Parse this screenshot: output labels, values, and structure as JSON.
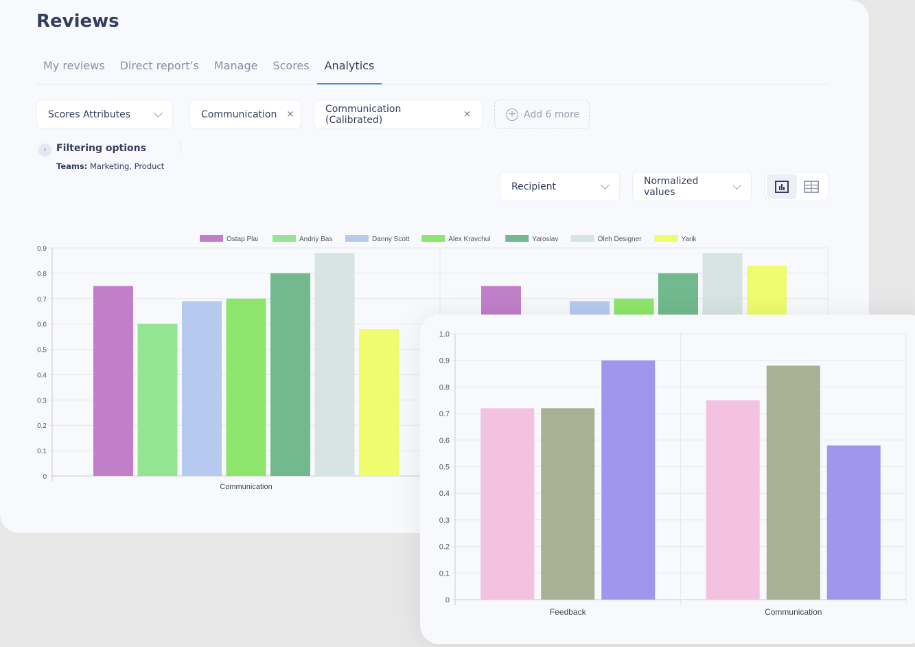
{
  "header": {
    "title": "Reviews"
  },
  "tabs": [
    {
      "label": "My reviews"
    },
    {
      "label": "Direct report’s"
    },
    {
      "label": "Manage"
    },
    {
      "label": "Scores"
    },
    {
      "label": "Analytics",
      "active": true
    }
  ],
  "filters": {
    "attribute_select": "Scores Attributes",
    "chips": [
      "Communication",
      "Communication (Calibrated)"
    ],
    "remove_icon": "×",
    "add_more": "Add 6 more"
  },
  "filtering": {
    "title": "Filtering options",
    "teams_label": "Teams:",
    "teams_value": "Marketing, Product"
  },
  "controls": {
    "group_by": "Recipient",
    "value_mode": "Normalized values",
    "view_toggle": [
      "bar-chart-icon",
      "table-icon"
    ],
    "active_view": "bar-chart-icon"
  },
  "accent_color": "#3d8ef0",
  "chart_data": [
    {
      "type": "bar",
      "legend_position": "top",
      "grid": true,
      "ylim": [
        0,
        0.9
      ],
      "yticks": [
        "0",
        "0.1",
        "0.2",
        "0.3",
        "0.4",
        "0.5",
        "0.6",
        "0.7",
        "0.8",
        "0.9"
      ],
      "categories": [
        "Communication",
        ""
      ],
      "series": [
        {
          "name": "Ostap Plai",
          "color": "#c17fca",
          "values": [
            0.75,
            0.75
          ]
        },
        {
          "name": "Andriy Bas",
          "color": "#93e593",
          "values": [
            0.6,
            null
          ]
        },
        {
          "name": "Danny Scott",
          "color": "#b6caf0",
          "values": [
            0.69,
            0.69
          ]
        },
        {
          "name": "Alex Kravchul",
          "color": "#8de66b",
          "values": [
            0.7,
            0.7
          ]
        },
        {
          "name": "Yaroslav",
          "color": "#72b98e",
          "values": [
            0.8,
            0.8
          ]
        },
        {
          "name": "Oleh Designer",
          "color": "#d8e4e2",
          "values": [
            0.88,
            0.88
          ]
        },
        {
          "name": "Yarik",
          "color": "#eefc6e",
          "values": [
            0.58,
            0.83
          ]
        }
      ]
    },
    {
      "type": "bar",
      "grid": true,
      "ylim": [
        0,
        1.0
      ],
      "yticks": [
        "0",
        "0.1",
        "0.2",
        "0.3",
        "0.4",
        "0.5",
        "0.6",
        "0.7",
        "0.8",
        "0.9",
        "1.0"
      ],
      "categories": [
        "Feedback",
        "Communication"
      ],
      "series": [
        {
          "color": "#f4c2e1",
          "values": [
            0.72,
            0.75
          ]
        },
        {
          "color": "#a9b093",
          "values": [
            0.72,
            0.88
          ]
        },
        {
          "color": "#a096ee",
          "values": [
            0.9,
            0.58
          ]
        }
      ]
    }
  ]
}
